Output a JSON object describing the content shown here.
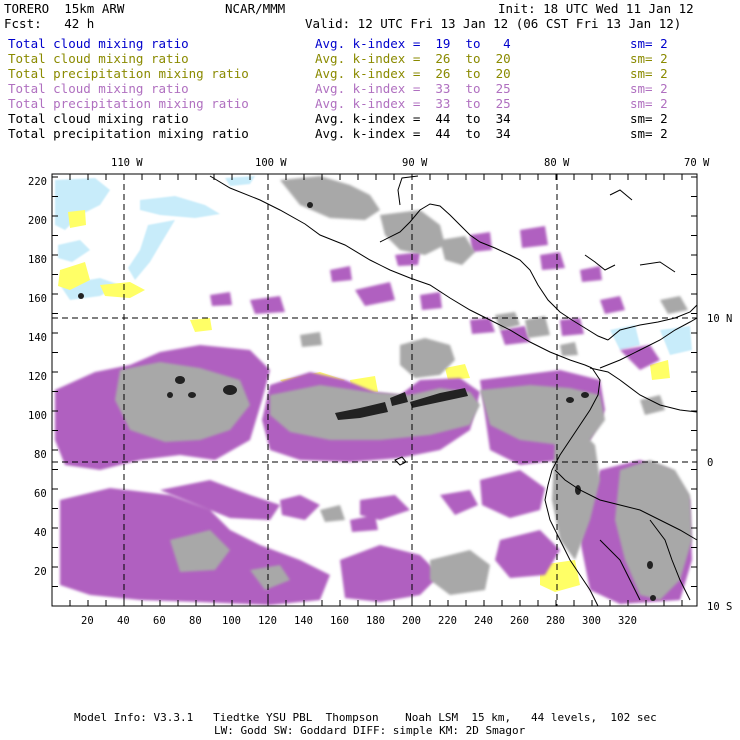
{
  "header": {
    "model": "TORERO  15km ARW",
    "org": "NCAR/MMM",
    "init": "Init: 18 UTC Wed 11 Jan 12",
    "fcst": "Fcst:   42 h",
    "valid": "Valid: 12 UTC Fri 13 Jan 12 (06 CST Fri 13 Jan 12)"
  },
  "legend": [
    {
      "field": "Total cloud mixing ratio",
      "kindex": "Avg. k-index =  19  to   4",
      "sm": "sm= 2",
      "color": "#0000cc"
    },
    {
      "field": "Total cloud mixing ratio",
      "kindex": "Avg. k-index =  26  to  20",
      "sm": "sm= 2",
      "color": "#8a8a00"
    },
    {
      "field": "Total precipitation mixing ratio",
      "kindex": "Avg. k-index =  26  to  20",
      "sm": "sm= 2",
      "color": "#8a8a00"
    },
    {
      "field": "Total cloud mixing ratio",
      "kindex": "Avg. k-index =  33  to  25",
      "sm": "sm= 2",
      "color": "#b070c0"
    },
    {
      "field": "Total precipitation mixing ratio",
      "kindex": "Avg. k-index =  33  to  25",
      "sm": "sm= 2",
      "color": "#b070c0"
    },
    {
      "field": "Total cloud mixing ratio",
      "kindex": "Avg. k-index =  44  to  34",
      "sm": "sm= 2",
      "color": "#000000"
    },
    {
      "field": "Total precipitation mixing ratio",
      "kindex": "Avg. k-index =  44  to  34",
      "sm": "sm= 2",
      "color": "#000000"
    }
  ],
  "map": {
    "lon_labels": [
      "110 W",
      "100 W",
      "90 W",
      "80 W",
      "70 W"
    ],
    "lat_labels": [
      "10 N",
      "0",
      "10 S"
    ],
    "y_ticks": [
      "220",
      "200",
      "180",
      "160",
      "140",
      "120",
      "100",
      "80",
      "60",
      "40",
      "20"
    ],
    "x_ticks": [
      "20",
      "40",
      "60",
      "80",
      "100",
      "120",
      "140",
      "160",
      "180",
      "200",
      "220",
      "240",
      "260",
      "280",
      "300",
      "320"
    ],
    "colors": {
      "light_blue": "#c8ecfa",
      "yellow": "#ffff66",
      "purple": "#b060c0",
      "gray": "#a8a8a8",
      "dark": "#222222"
    }
  },
  "footer": {
    "line1": "Model Info: V3.3.1   Tiedtke YSU PBL  Thompson    Noah LSM  15 km,   44 levels,  102 sec",
    "line2": "LW: Godd SW: Goddard DIFF: simple KM: 2D Smagor"
  }
}
